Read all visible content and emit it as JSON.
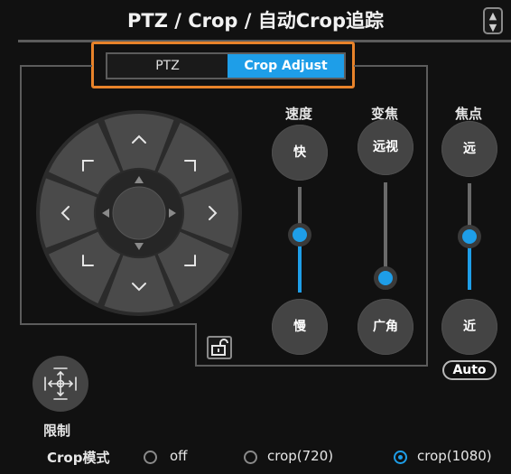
{
  "title": "PTZ / Crop / 自动Crop追踪",
  "tabs": [
    {
      "label": "PTZ",
      "active": false
    },
    {
      "label": "Crop Adjust",
      "active": true
    }
  ],
  "speed": {
    "label": "速度",
    "fast": "快",
    "slow": "慢",
    "level": 0.55
  },
  "zoom": {
    "label": "变焦",
    "tele": "远视",
    "wide": "广角",
    "level": 0.1
  },
  "focus": {
    "label": "焦点",
    "far": "远",
    "near": "近",
    "level": 0.5,
    "auto_label": "Auto"
  },
  "limit": {
    "label": "限制"
  },
  "crop_mode": {
    "label": "Crop模式",
    "options": [
      {
        "label": "off",
        "selected": false
      },
      {
        "label": "crop(720)",
        "selected": false
      },
      {
        "label": "crop(1080)",
        "selected": true
      }
    ]
  },
  "colors": {
    "accent": "#1e9ee8",
    "highlight": "#e8832a",
    "background": "#111111",
    "button": "#444444"
  },
  "icons": [
    "chevron-up-icon",
    "chevron-down-icon",
    "chevron-left-icon",
    "chevron-right-icon",
    "corner-up-left-icon",
    "corner-up-right-icon",
    "corner-down-left-icon",
    "corner-down-right-icon",
    "unlock-icon",
    "move-limit-icon"
  ]
}
